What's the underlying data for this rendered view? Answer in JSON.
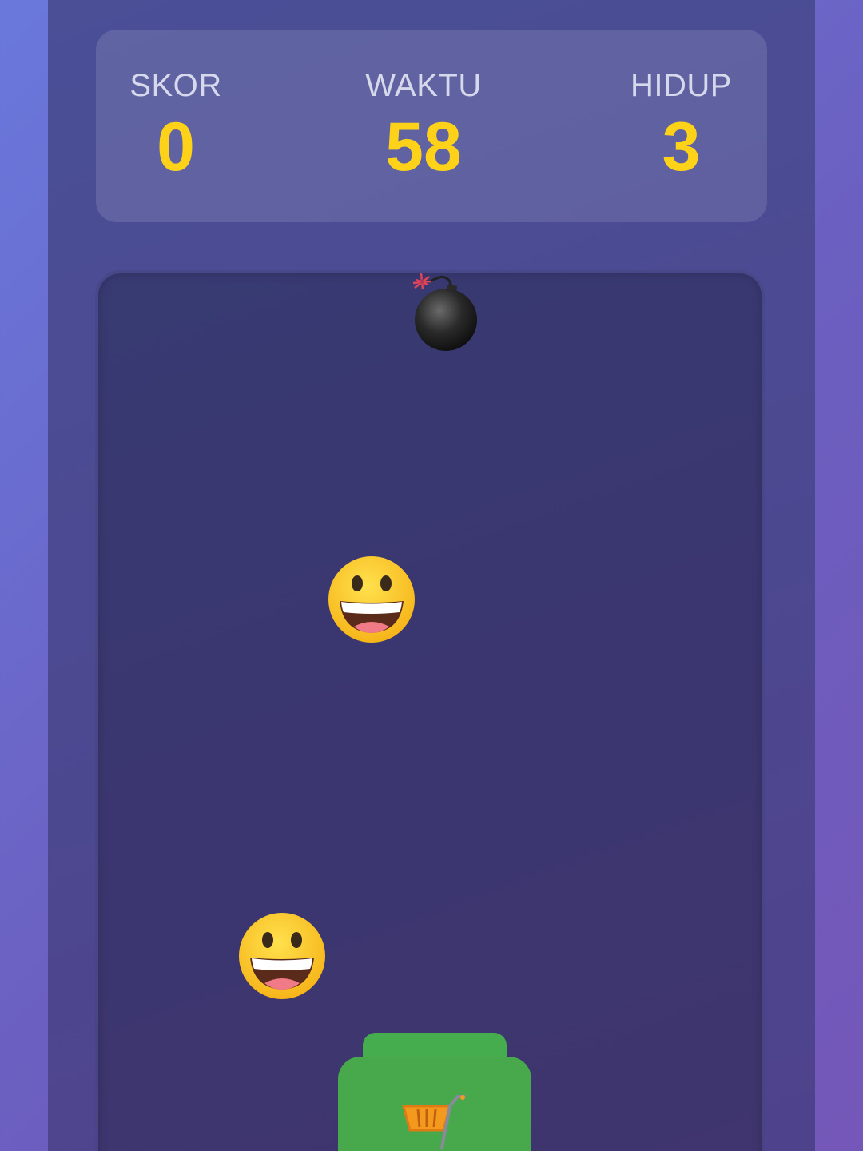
{
  "hud": {
    "score_label": "SKOR",
    "score_value": "0",
    "time_label": "WAKTU",
    "time_value": "58",
    "lives_label": "HIDUP",
    "lives_value": "3"
  },
  "falling_items": [
    {
      "kind": "bomb",
      "icon": "bomb-icon"
    },
    {
      "kind": "smiley",
      "icon": "grinning-face-icon"
    },
    {
      "kind": "smiley",
      "icon": "grinning-face-icon"
    }
  ],
  "player": {
    "icon": "shopping-cart-icon"
  },
  "colors": {
    "accent_value": "#ffd21a",
    "label": "#d6d8ec",
    "basket_green": "#47a94c",
    "play_area": "#3b3670",
    "panel": "#4c4991"
  }
}
